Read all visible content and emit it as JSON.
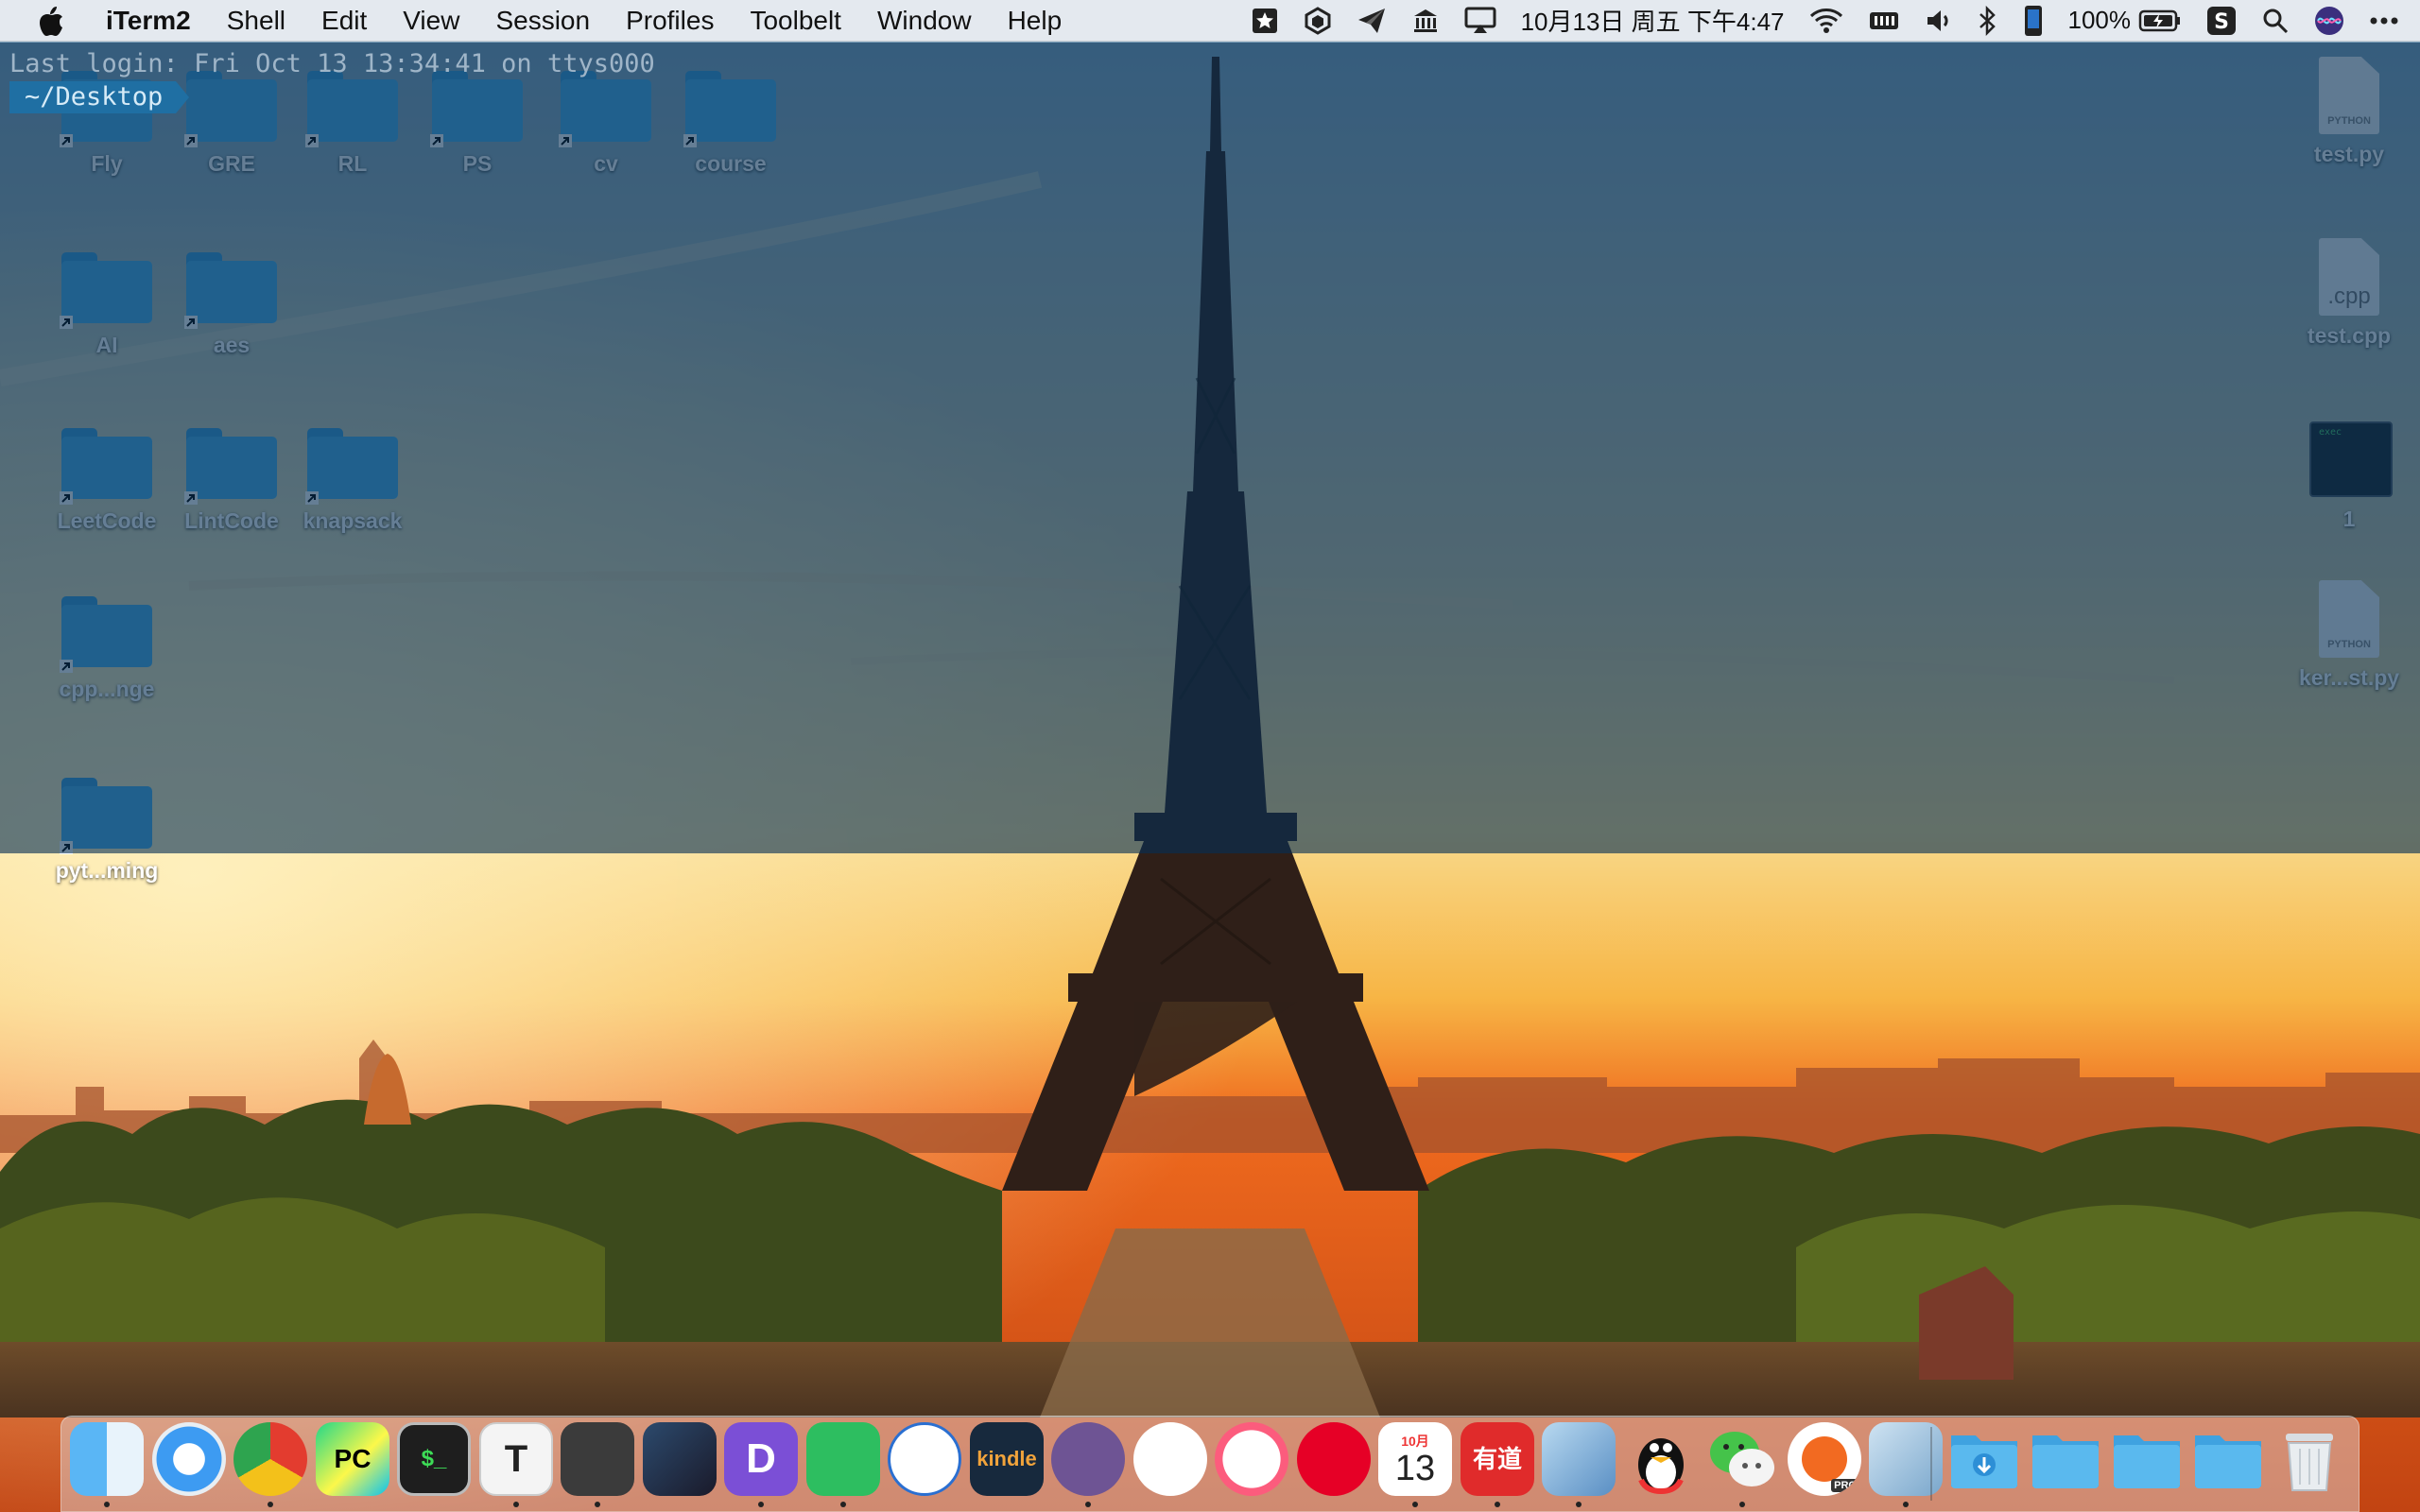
{
  "menubar": {
    "app_name": "iTerm2",
    "menus": [
      "Shell",
      "Edit",
      "View",
      "Session",
      "Profiles",
      "Toolbelt",
      "Window",
      "Help"
    ],
    "datetime": "10月13日 周五 下午4:47",
    "battery_percent": "100%",
    "status_icons": [
      "star-icon",
      "cube-icon",
      "paper-plane-icon",
      "library-icon",
      "airplay-icon",
      "wifi-icon",
      "memory-icon",
      "volume-icon",
      "bluetooth-icon",
      "phone-icon",
      "battery-icon",
      "sogou-input-icon",
      "spotlight-icon",
      "siri-icon",
      "more-icon"
    ]
  },
  "terminal": {
    "last_login": "Last login: Fri Oct 13 13:34:41 on ttys000",
    "prompt_path": "~/Desktop"
  },
  "desktop": {
    "left_items": [
      {
        "label": "Fly",
        "kind": "folder"
      },
      {
        "label": "GRE",
        "kind": "folder"
      },
      {
        "label": "RL",
        "kind": "folder"
      },
      {
        "label": "PS",
        "kind": "folder"
      },
      {
        "label": "cv",
        "kind": "folder"
      },
      {
        "label": "course",
        "kind": "folder"
      },
      {
        "label": "AI",
        "kind": "folder"
      },
      {
        "label": "aes",
        "kind": "folder"
      },
      {
        "label": "LeetCode",
        "kind": "folder"
      },
      {
        "label": "LintCode",
        "kind": "folder"
      },
      {
        "label": "knapsack",
        "kind": "folder"
      },
      {
        "label": "cpp...nge",
        "kind": "folder"
      },
      {
        "label": "pyt...ming",
        "kind": "folder"
      }
    ],
    "right_items": [
      {
        "label": "test.py",
        "kind": "python",
        "tag": "PYTHON"
      },
      {
        "label": "test.cpp",
        "kind": "cpp",
        "tag": ".cpp"
      },
      {
        "label": "1",
        "kind": "exec",
        "tag": "exec"
      },
      {
        "label": "ker...st.py",
        "kind": "python",
        "tag": "PYTHON"
      }
    ]
  },
  "dock": {
    "apps": [
      {
        "name": "Finder",
        "icon": "finder-icon",
        "running": true
      },
      {
        "name": "Safari",
        "icon": "safari-icon",
        "running": false
      },
      {
        "name": "Google Chrome",
        "icon": "chrome-icon",
        "running": true
      },
      {
        "name": "PyCharm",
        "icon": "pycharm-icon",
        "running": false,
        "text": "PC"
      },
      {
        "name": "Terminal",
        "icon": "terminal-icon",
        "running": false,
        "text": "$_"
      },
      {
        "name": "Typora",
        "icon": "typora-icon",
        "running": true,
        "text": "T"
      },
      {
        "name": "Sublime Text",
        "icon": "sublime-icon",
        "running": true
      },
      {
        "name": "Xcode",
        "icon": "xcode-icon",
        "running": false
      },
      {
        "name": "Dash",
        "icon": "dash-icon",
        "running": true,
        "text": "D"
      },
      {
        "name": "Evernote",
        "icon": "evernote-icon",
        "running": true
      },
      {
        "name": "Library",
        "icon": "library-icon",
        "running": false
      },
      {
        "name": "Kindle",
        "icon": "kindle-icon",
        "running": false,
        "text": "kindle"
      },
      {
        "name": "GitHub Desktop",
        "icon": "github-icon",
        "running": true
      },
      {
        "name": "Baidu Netdisk",
        "icon": "baidu-netdisk-icon",
        "running": false
      },
      {
        "name": "iTunes",
        "icon": "itunes-icon",
        "running": false
      },
      {
        "name": "NetEase Music",
        "icon": "netease-music-icon",
        "running": false
      },
      {
        "name": "Calendar",
        "icon": "calendar-icon",
        "running": true,
        "month": "10月",
        "day": "13"
      },
      {
        "name": "Youdao Dictionary",
        "icon": "youdao-icon",
        "running": true,
        "text": "有道"
      },
      {
        "name": "Mail",
        "icon": "mail-icon",
        "running": true
      },
      {
        "name": "QQ",
        "icon": "qq-icon",
        "running": false
      },
      {
        "name": "WeChat",
        "icon": "wechat-icon",
        "running": true
      },
      {
        "name": "Instastats Pro",
        "icon": "instastats-icon",
        "running": false,
        "badge": "PRO"
      },
      {
        "name": "Preview",
        "icon": "preview-icon",
        "running": true
      }
    ],
    "stacks": [
      {
        "name": "Downloads",
        "icon": "downloads-folder-icon"
      },
      {
        "name": "Folder",
        "icon": "folder-icon"
      },
      {
        "name": "Folder",
        "icon": "folder-icon"
      },
      {
        "name": "Folder",
        "icon": "folder-icon"
      },
      {
        "name": "Trash",
        "icon": "trash-icon"
      }
    ]
  },
  "colors": {
    "terminal_tint": "#062e54",
    "prompt_segment": "#1f6fa3",
    "folder_blue": "#4ab0ea",
    "sky_top": "#f8d98a",
    "sky_bottom": "#ef6a1e"
  }
}
